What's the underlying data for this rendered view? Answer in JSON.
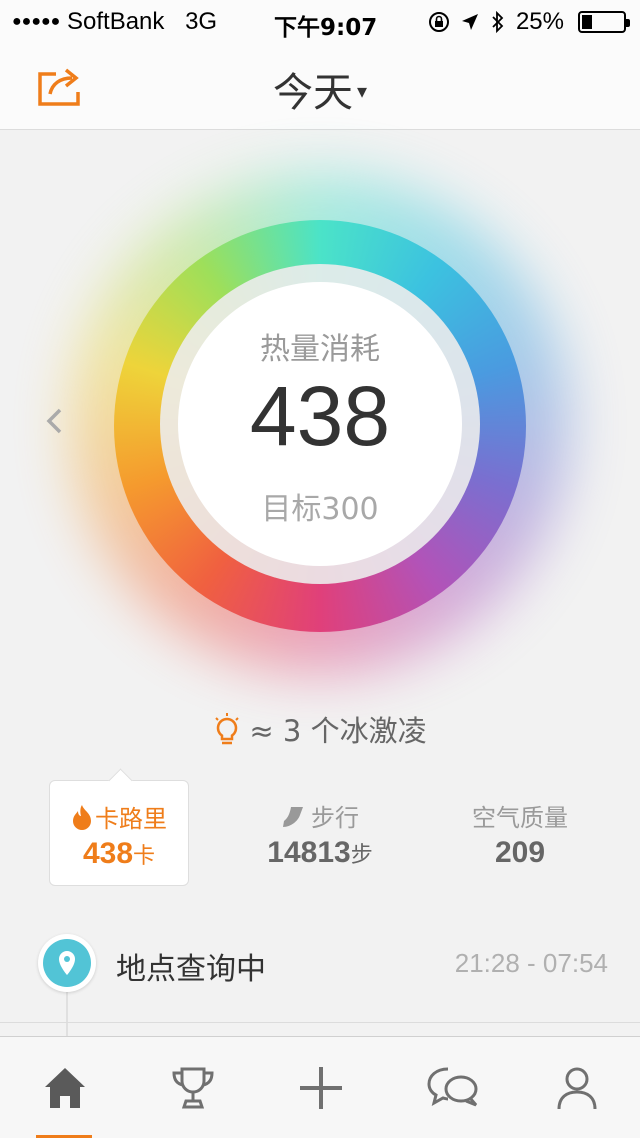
{
  "status_bar": {
    "signal_dots": "●●●●●",
    "carrier": "SoftBank",
    "network": "3G",
    "time": "下午9:07",
    "battery_text": "25%",
    "battery_level": 0.25
  },
  "nav": {
    "title": "今天",
    "caret": "▾",
    "share_icon": "share-icon"
  },
  "ring": {
    "label": "热量消耗",
    "value": "438",
    "goal": "目标300",
    "progress_colors": [
      "#4be3c8",
      "#3cc2e0",
      "#4a9be0",
      "#7a6fd0",
      "#b253b8",
      "#e0407a",
      "#f06040",
      "#f59a2e",
      "#eed43a",
      "#9edf5a"
    ]
  },
  "tip": {
    "icon": "lightbulb-icon",
    "text": "≈ 3 个冰激凌"
  },
  "stats": [
    {
      "icon": "flame-icon",
      "label": "卡路里",
      "value": "438",
      "unit": "卡",
      "active": true
    },
    {
      "icon": "shoe-icon",
      "label": "步行",
      "value": "14813",
      "unit": "步",
      "active": false
    },
    {
      "icon": "",
      "label": "空气质量",
      "value": "209",
      "unit": "",
      "active": false
    }
  ],
  "location": {
    "icon": "location-pin-icon",
    "text": "地点查询中",
    "time_range": "21:28 - 07:54"
  },
  "tab_bar": [
    {
      "icon": "home-icon",
      "active": true
    },
    {
      "icon": "trophy-icon",
      "active": false
    },
    {
      "icon": "plus-icon",
      "active": false
    },
    {
      "icon": "chat-icon",
      "active": false
    },
    {
      "icon": "person-icon",
      "active": false
    }
  ],
  "colors": {
    "accent": "#ef7d1a",
    "location": "#52c4d6",
    "icon_gray": "#707070"
  }
}
